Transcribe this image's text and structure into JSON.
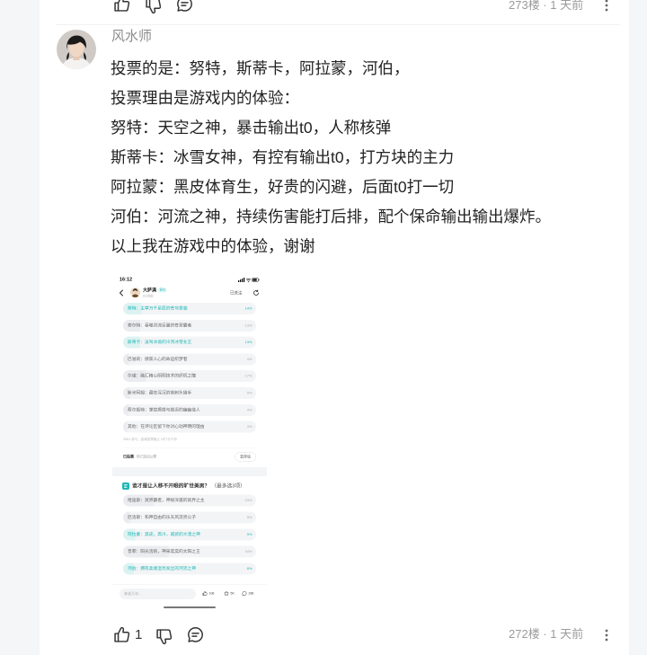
{
  "colors": {
    "accent": "#1cb7b4",
    "text": "#222222",
    "muted": "#9b9b9b",
    "page_background": "#f5f6f7",
    "card_background": "#ffffff"
  },
  "icons": {
    "like": "thumbs-up-icon",
    "dislike": "thumbs-down-icon",
    "reply": "comment-icon",
    "more": "more-vertical-icon",
    "back": "chevron-left-icon",
    "refresh": "refresh-icon",
    "favorite": "star-icon",
    "poll": "poll-icon"
  },
  "previous_comment": {
    "floor_time": "273楼 · 1 天前"
  },
  "comment": {
    "username": "风水师",
    "lines": [
      "投票的是：努特，斯蒂卡，阿拉蒙，河伯，",
      "投票理由是游戏内的体验：",
      "努特：天空之神，暴击输出t0，人称核弹",
      "斯蒂卡：冰雪女神，有控有输出t0，打方块的主力",
      "阿拉蒙：黑皮体育生，好贵的闪避，后面t0打一切",
      "河伯：河流之神，持续伤害能打后排，配个保命输出输出爆炸。",
      "以上我在游戏中的体验，谢谢"
    ],
    "attachment": {
      "status_time": "16:12",
      "author": {
        "name": "大萨满",
        "badge": "官方",
        "time": "8小时前"
      },
      "follow_label": "已关注",
      "poll1": {
        "options": [
          {
            "label": "努特：主宰万千星辰的苍穹君临",
            "percent": 14,
            "voted": true
          },
          {
            "label": "索尔特：吞噬洪流巨翼的苍翠霸者",
            "percent": 13,
            "voted": false
          },
          {
            "label": "斯蒂卡：凌驾冰境的冷冽冰雪女王",
            "percent": 13,
            "voted": true
          },
          {
            "label": "巴滋莉：掠获人心的命运织梦者",
            "percent": 4,
            "voted": false
          },
          {
            "label": "尔诺：融汇精心阴阳技术的织机之瞳",
            "percent": 17,
            "voted": false
          },
          {
            "label": "斯米阿姆：藏在深沉的劳刺头猎手",
            "percent": 5,
            "voted": false
          },
          {
            "label": "蔡尔姬特：掌控撩拨与挑逗的幽幽佳人",
            "percent": 4,
            "voted": false
          },
          {
            "label": "其他：在评论区留下你对心动神明的理由",
            "percent": 3,
            "voted": false
          }
        ],
        "participants": "388人参与，距离投票截止 1时7分37秒",
        "voted_label": "已投票",
        "voted_note": "你已投出2票",
        "comment_button": "去评论"
      },
      "poll2": {
        "title": "谁才是让人移不开眼的旷世美男？",
        "title_note": "（最多选3项）",
        "options": [
          {
            "label": "哈迪斯：冥界霸者，神秘深邃的冥界之主",
            "percent": 23,
            "voted": false
          },
          {
            "label": "厄洛斯：和神自由的乐天风流贵公子",
            "percent": 5,
            "voted": false
          },
          {
            "label": "阿拉蒙：黑皮，高冷，威武的大漠之神",
            "percent": 9,
            "voted": true
          },
          {
            "label": "普菲：阳光活跃，神采奕奕的太阳之王",
            "percent": 34,
            "voted": false
          },
          {
            "label": "河伯：拥有柔顺湿亮发丝的河流之神",
            "percent": 8,
            "voted": true
          }
        ]
      },
      "reply_bar": {
        "placeholder": "来说几句...",
        "likes": "108",
        "favorites": "5K",
        "comments": "286"
      }
    }
  },
  "footer": {
    "like_count": "1",
    "floor_time": "272楼 · 1 天前"
  }
}
